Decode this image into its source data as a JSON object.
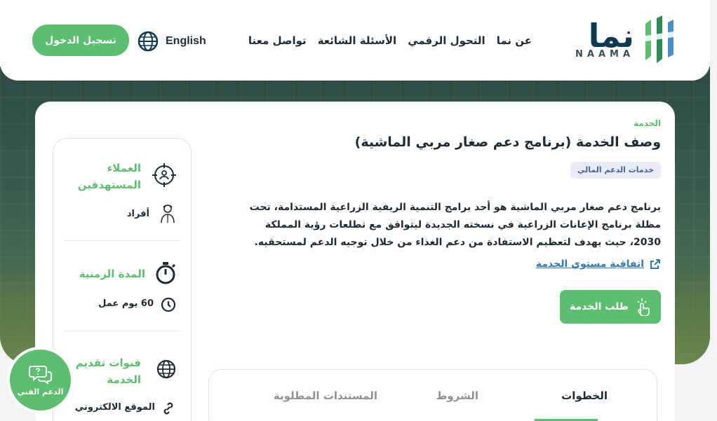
{
  "header": {
    "logo_word": "نما",
    "logo_latin": "NAAMA",
    "nav": [
      "عن نما",
      "التحول الرقمي",
      "الأسئلة الشائعة",
      "تواصل معنا"
    ],
    "language": "English",
    "login_label": "تسجيل الدخول"
  },
  "service": {
    "breadcrumb": "الخدمة",
    "title": "وصف الخدمة (برنامج دعم صغار مربي الماشية)",
    "category_badge": "خدمات الدعم المالي",
    "description": "برنامج دعم صغار مربي الماشية هو أحد برامج التنمية الريفية الزراعية المستدامة، تحت مظلة برنامج الإعانات الزراعية في نسخته الجديدة ليتوافق مع تطلعات رؤية المملكة 2030، حيث يهدف لتعظيم الاستفادة من دعم الغذاء من خلال توجيه الدعم لمستحقيه.",
    "sla_link": "اتفاقية مستوي الخدمة",
    "request_button": "طلب الخدمة"
  },
  "sidebar": {
    "target": {
      "title": "العملاء المستهدفين",
      "value": "أفراد"
    },
    "duration": {
      "title": "المدة الزمنية",
      "value": "60 يوم عمل"
    },
    "channels": {
      "title": "قنوات تقديم الخدمة",
      "value": "الموقع الالكتروني"
    }
  },
  "tabs": {
    "items": [
      "الخطوات",
      "الشروط",
      "المستندات المطلوبة"
    ],
    "active_index": 0
  },
  "support": {
    "label": "الدعم الفني"
  },
  "colors": {
    "accent": "#5cbf6f",
    "brand_dark": "#0f3b52",
    "link": "#2f7ab8"
  }
}
